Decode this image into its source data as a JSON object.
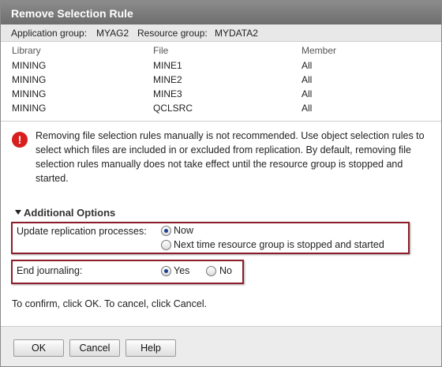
{
  "dialog": {
    "title": "Remove Selection Rule",
    "application_group_label": "Application group:",
    "application_group": "MYAG2",
    "resource_group_label": "Resource group:",
    "resource_group": "MYDATA2"
  },
  "table": {
    "headers": [
      "Library",
      "File",
      "Member"
    ],
    "rows": [
      [
        "MINING",
        "MINE1",
        "All"
      ],
      [
        "MINING",
        "MINE2",
        "All"
      ],
      [
        "MINING",
        "MINE3",
        "All"
      ],
      [
        "MINING",
        "QCLSRC",
        "All"
      ]
    ]
  },
  "warning": {
    "icon": "error-icon",
    "icon_glyph": "!",
    "text": "Removing file selection rules manually is not recommended. Use object selection rules to select which files are included in or excluded from replication. By default, removing file selection rules manually does not take effect until the resource group is stopped and started."
  },
  "options": {
    "heading": "Additional Options",
    "update_label": "Update replication processes:",
    "update_now": "Now",
    "update_next": "Next time resource group is stopped and started",
    "update_selected": "now",
    "journal_label": "End journaling:",
    "journal_yes": "Yes",
    "journal_no": "No",
    "journal_selected": "yes"
  },
  "confirm_text": "To confirm, click OK. To cancel, click Cancel.",
  "buttons": {
    "ok": "OK",
    "cancel": "Cancel",
    "help": "Help"
  },
  "colors": {
    "titlebar": "#7a7a7a",
    "highlight": "#8b1e2a",
    "error": "#d81e1e"
  }
}
